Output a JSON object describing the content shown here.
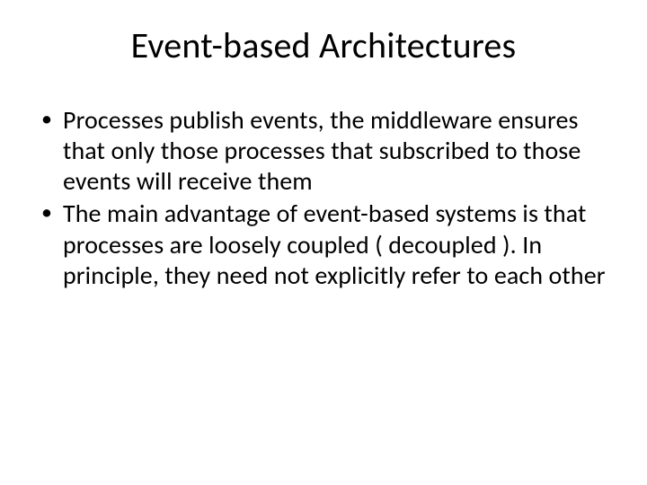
{
  "title": "Event-based Architectures",
  "bullets": [
    "Processes publish events, the middleware ensures that only those processes that subscribed to those events will receive them",
    "The main advantage of event-based systems is that processes are loosely coupled ( decoupled ). In principle, they need not explicitly refer to each other"
  ]
}
